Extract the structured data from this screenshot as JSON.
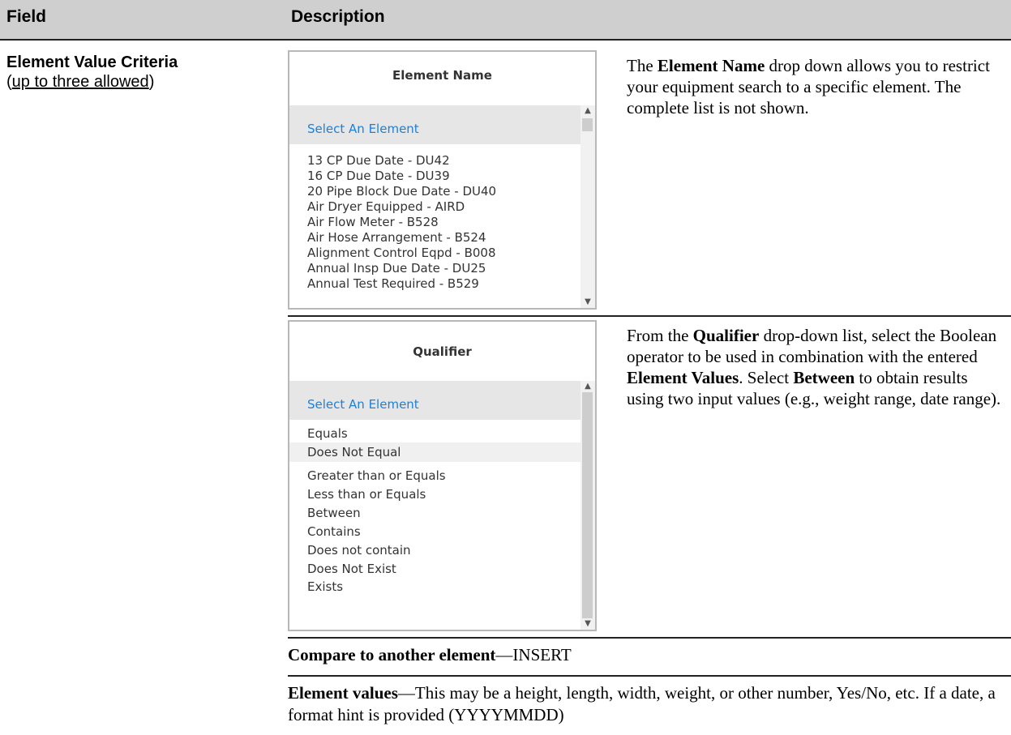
{
  "table": {
    "header": {
      "field": "Field",
      "description": "Description"
    },
    "field_name": {
      "title": "Element Value Criteria",
      "note_open": "(",
      "note_underlined": "up to three allowed",
      "note_close": ")"
    }
  },
  "element_name_dropdown": {
    "header": "Element Name",
    "selected": "Select An Element",
    "options": [
      "13 CP Due Date - DU42",
      "16 CP Due Date - DU39",
      "20 Pipe Block Due Date - DU40",
      "Air Dryer Equipped - AIRD",
      "Air Flow Meter - B528",
      "Air Hose Arrangement - B524",
      "Alignment Control Eqpd - B008",
      "Annual Insp Due Date - DU25",
      "Annual Test Required - B529"
    ]
  },
  "element_name_desc": {
    "p1": "The ",
    "b1": "Element Name",
    "p2": " drop down allows you to restrict your equipment search to a specific element. The complete list is not shown."
  },
  "qualifier_dropdown": {
    "header": "Qualifier",
    "selected": "Select An Element",
    "options": [
      "Equals",
      "Does Not Equal",
      "Greater than or Equals",
      "Less than or Equals",
      "Between",
      "Contains",
      "Does not contain",
      "Does Not Exist",
      "Exists"
    ]
  },
  "qualifier_desc": {
    "p1": "From the ",
    "b1": "Qualifier",
    "p2": " drop-down list, select the Boolean operator to be used in combination with the entered ",
    "b2": "Element Values",
    "p3": ". Select ",
    "b3": "Between",
    "p4": " to obtain results using two input values (e.g., weight range, date range)."
  },
  "compare": {
    "bold": "Compare to another element",
    "rest": "—INSERT"
  },
  "element_values": {
    "bold": "Element values",
    "rest": "—This may be a height, length, width, weight, or other number, Yes/No, etc. If a date, a format hint is provided (YYYYMMDD)"
  }
}
